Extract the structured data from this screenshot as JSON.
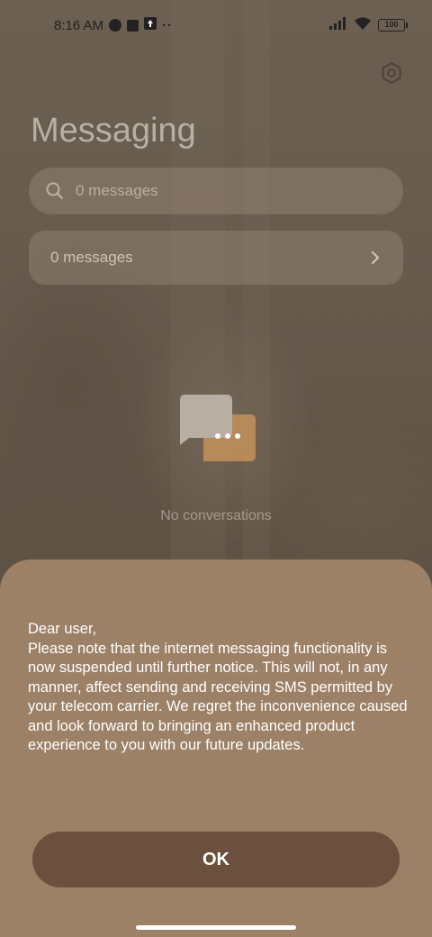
{
  "status_bar": {
    "time": "8:16 AM",
    "battery": "100",
    "icons": [
      "app-notification-icon",
      "stop-icon",
      "upload-icon",
      "more-dots-icon",
      "signal-icon",
      "wifi-icon",
      "battery-icon"
    ]
  },
  "header": {
    "title": "Messaging",
    "settings_icon": "settings-hex-icon"
  },
  "search": {
    "placeholder": "0 messages",
    "icon": "search-icon"
  },
  "summary": {
    "label": "0 messages",
    "icon": "chevron-right-icon"
  },
  "empty_state": {
    "icon": "chat-bubbles-icon",
    "text": "No conversations"
  },
  "dialog": {
    "message": "Dear user,\nPlease note that the internet messaging functionality is now suspended until further notice. This will not, in any manner, affect sending and receiving SMS permitted by your telecom carrier. We regret the inconvenience caused and look forward to bringing an enhanced product experience to you with our future updates.",
    "ok_label": "OK"
  },
  "colors": {
    "sheet": "#9c8167",
    "ok_button": "#6a503d",
    "accent_bubble": "#d6a45a"
  }
}
